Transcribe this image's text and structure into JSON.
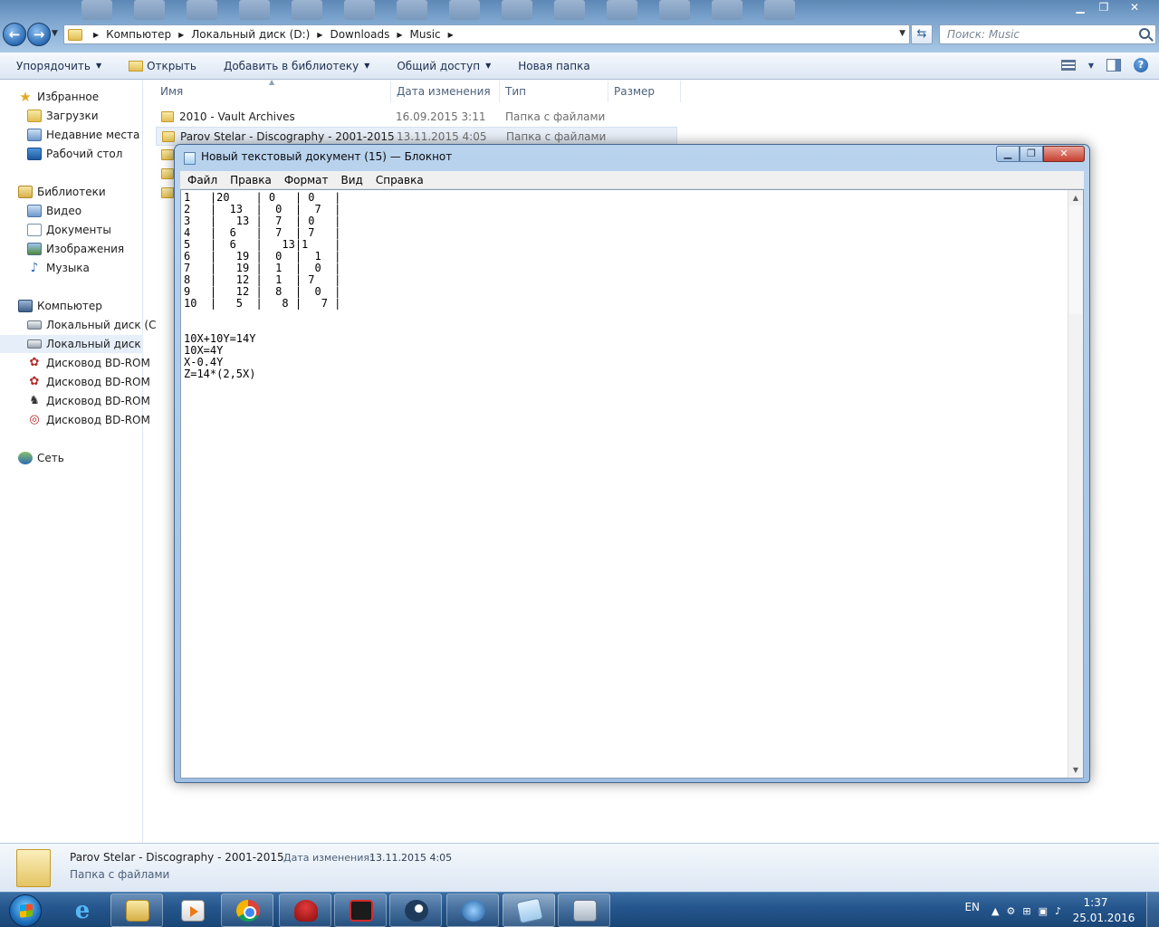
{
  "explorer": {
    "address": {
      "crumbs": [
        "Компьютер",
        "Локальный диск (D:)",
        "Downloads",
        "Music"
      ]
    },
    "search_placeholder": "Поиск: Music",
    "toolbar": {
      "organize": "Упорядочить",
      "open": "Открыть",
      "add_to_library": "Добавить в библиотеку",
      "share": "Общий доступ",
      "new_folder": "Новая папка"
    },
    "sidebar": {
      "favorites": "Избранное",
      "downloads": "Загрузки",
      "recent": "Недавние места",
      "desktop": "Рабочий стол",
      "libraries": "Библиотеки",
      "video": "Видео",
      "documents": "Документы",
      "pictures": "Изображения",
      "music": "Музыка",
      "computer": "Компьютер",
      "disk_c": "Локальный диск (C",
      "disk_d": "Локальный диск (D",
      "bd1": "Дисковод BD-ROM",
      "bd2": "Дисковод BD-ROM",
      "bd3": "Дисковод BD-ROM",
      "bd4": "Дисковод BD-ROM",
      "network": "Сеть"
    },
    "columns": {
      "name": "Имя",
      "date": "Дата изменения",
      "type": "Тип",
      "size": "Размер"
    },
    "files": [
      {
        "name": "2010 - Vault Archives",
        "date": "16.09.2015 3:11",
        "type": "Папка с файлами"
      },
      {
        "name": "Parov Stelar - Discography - 2001-2015",
        "date": "13.11.2015 4:05",
        "type": "Папка с файлами"
      }
    ],
    "details": {
      "name": "Parov Stelar - Discography - 2001-2015",
      "modified_label": "Дата изменения:",
      "modified_value": "13.11.2015 4:05",
      "kind": "Папка с файлами"
    }
  },
  "notepad": {
    "title": "Новый текстовый документ (15) — Блокнот",
    "menu": {
      "file": "Файл",
      "edit": "Правка",
      "format": "Формат",
      "view": "Вид",
      "help": "Справка"
    },
    "content": "1   |20    | 0   | 0   |\n2   |  13  |  0  |  7  |\n3   |   13 |  7  | 0   |\n4   |  6   |  7  | 7   |\n5   |  6   |   13|1    |\n6   |   19 |  0  |  1  |\n7   |   19 |  1  |  0  |\n8   |   12 |  1  | 7   |\n9   |   12 |  8  |  0  |\n10  |   5  |   8 |   7 |\n\n\n10X+10Y=14Y\n10X=4Y\nX-0.4Y\nZ=14*(2,5X)"
  },
  "taskbar": {
    "lang": "EN",
    "time": "1:37",
    "date": "25.01.2016"
  }
}
